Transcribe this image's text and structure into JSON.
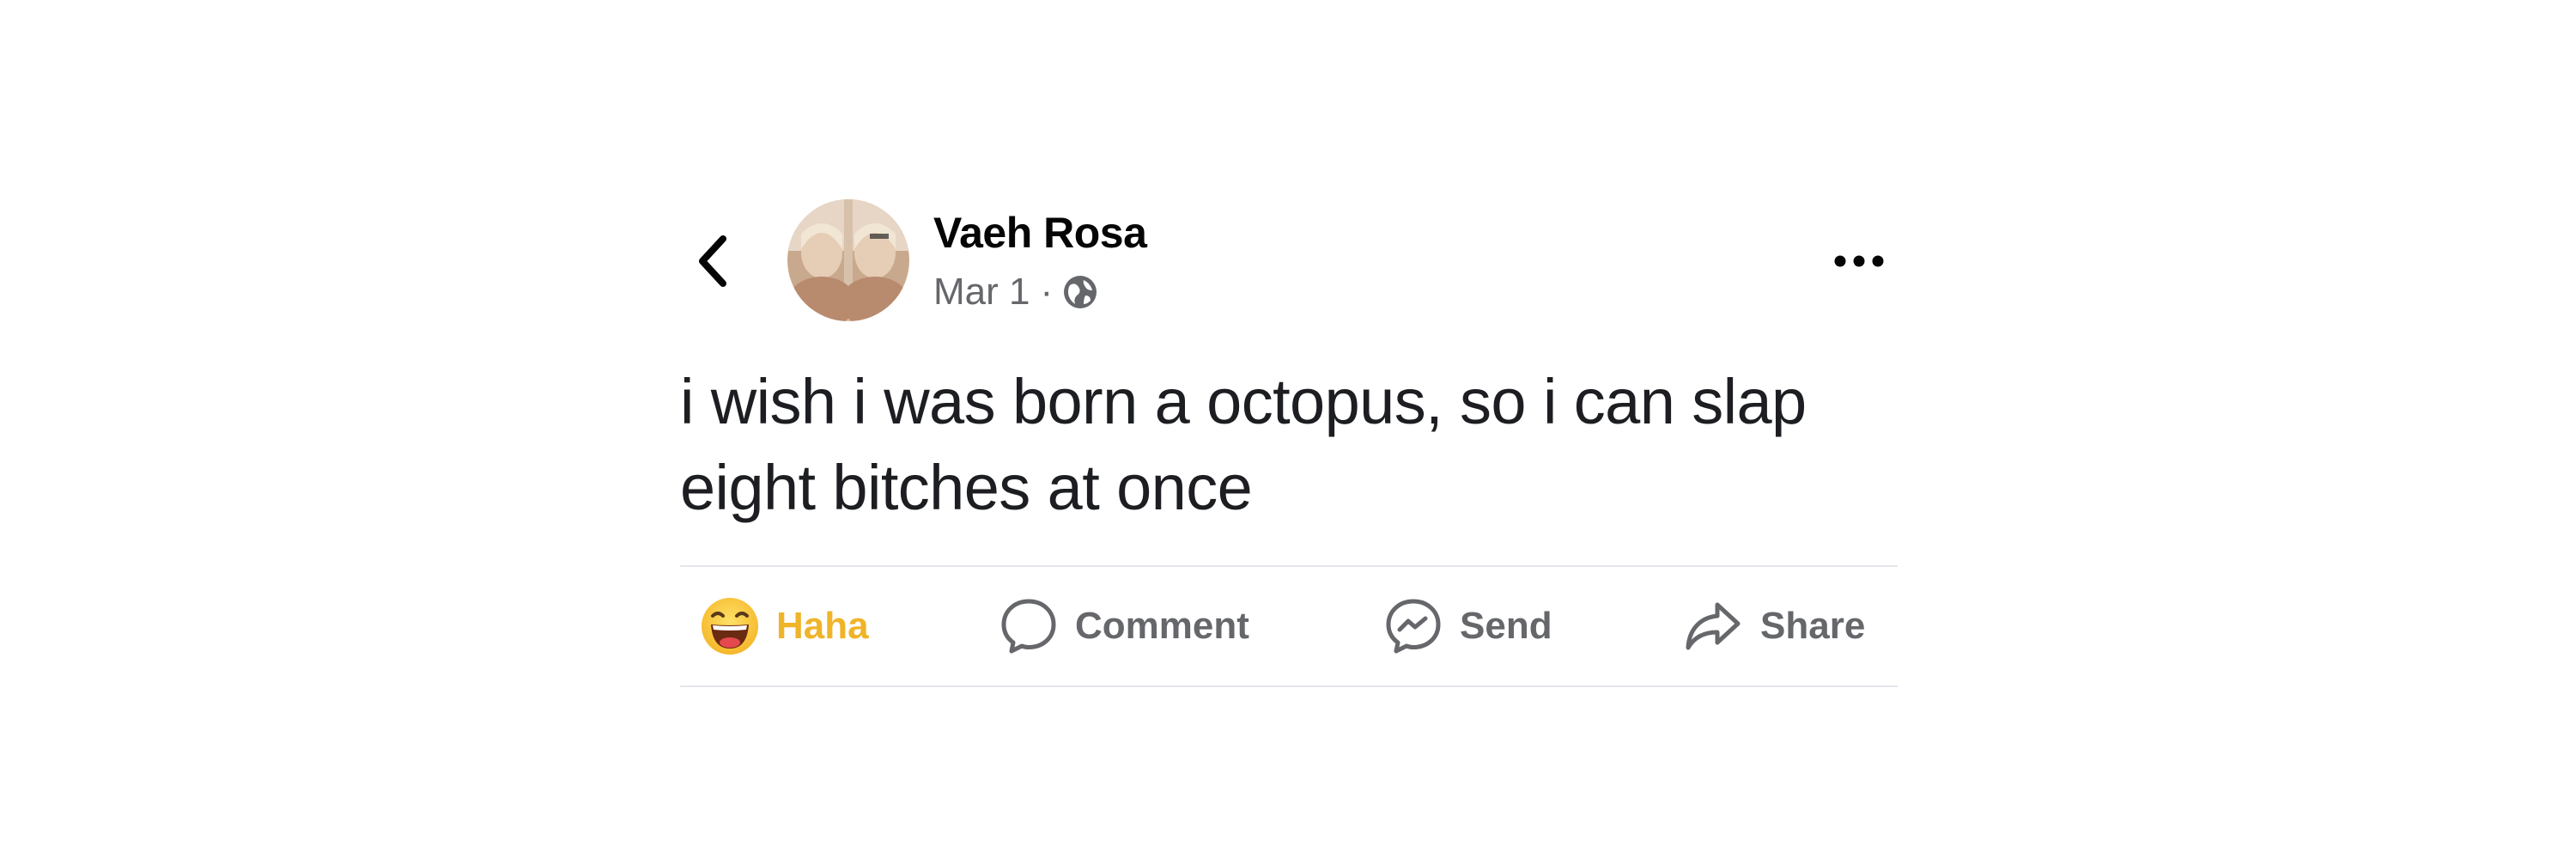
{
  "post": {
    "author_name": "Vaeh Rosa",
    "date": "Mar 1",
    "separator": "·",
    "privacy_icon": "globe-icon",
    "text": "i wish i was born a octopus, so i can slap eight bitches at once"
  },
  "actions": {
    "reaction_label": "Haha",
    "comment_label": "Comment",
    "send_label": "Send",
    "share_label": "Share"
  },
  "icons": {
    "back": "chevron-left-icon",
    "more": "more-dots-icon",
    "reaction": "haha-emoji-icon",
    "comment": "speech-bubble-icon",
    "send": "messenger-icon",
    "share": "share-arrow-icon"
  },
  "colors": {
    "reaction_active": "#f0b429",
    "secondary_text": "#65676b",
    "divider": "#e4e6eb",
    "primary_text": "#050505"
  }
}
